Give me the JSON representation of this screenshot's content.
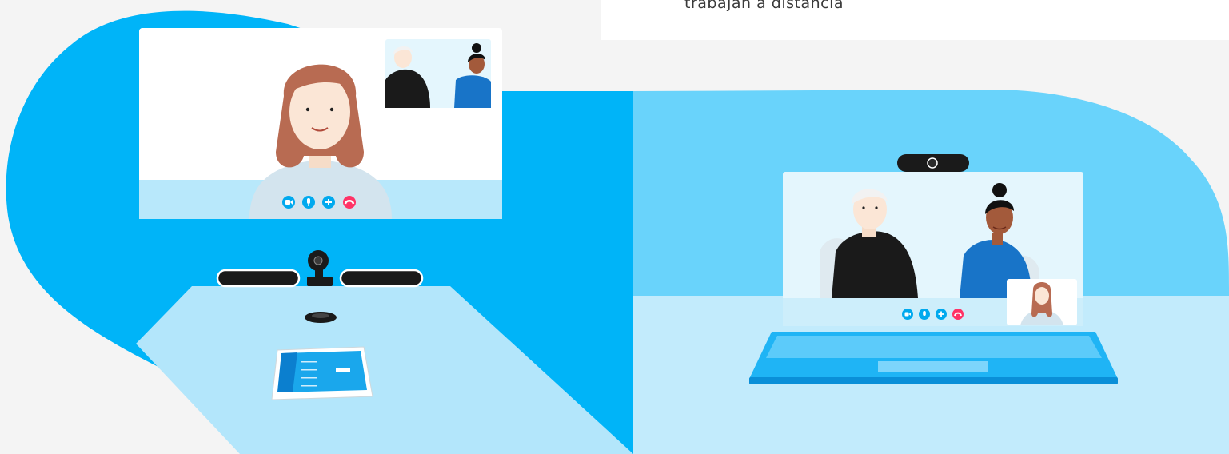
{
  "caption": {
    "text": "trabajan a distancia"
  },
  "room_panel": {
    "call_controls": [
      "camera-icon",
      "microphone-icon",
      "add-participant-icon",
      "end-call-icon"
    ],
    "devices": [
      "video-bar-left",
      "conference-camera",
      "video-bar-right",
      "speakerphone-puck",
      "touch-controller-tablet"
    ]
  },
  "laptop_panel": {
    "call_controls": [
      "camera-icon",
      "microphone-icon",
      "add-participant-icon",
      "end-call-icon"
    ],
    "devices": [
      "webcam",
      "laptop"
    ]
  },
  "colors": {
    "primary_blue": "#00b4f8",
    "light_blue": "#69d3fb",
    "pale_blue": "#b3e6fb",
    "screen_bg": "#e4f6fd",
    "end_call_red": "#ff3366",
    "dark_device": "#1a1a1a",
    "laptop_blue": "#0ea5f0"
  }
}
